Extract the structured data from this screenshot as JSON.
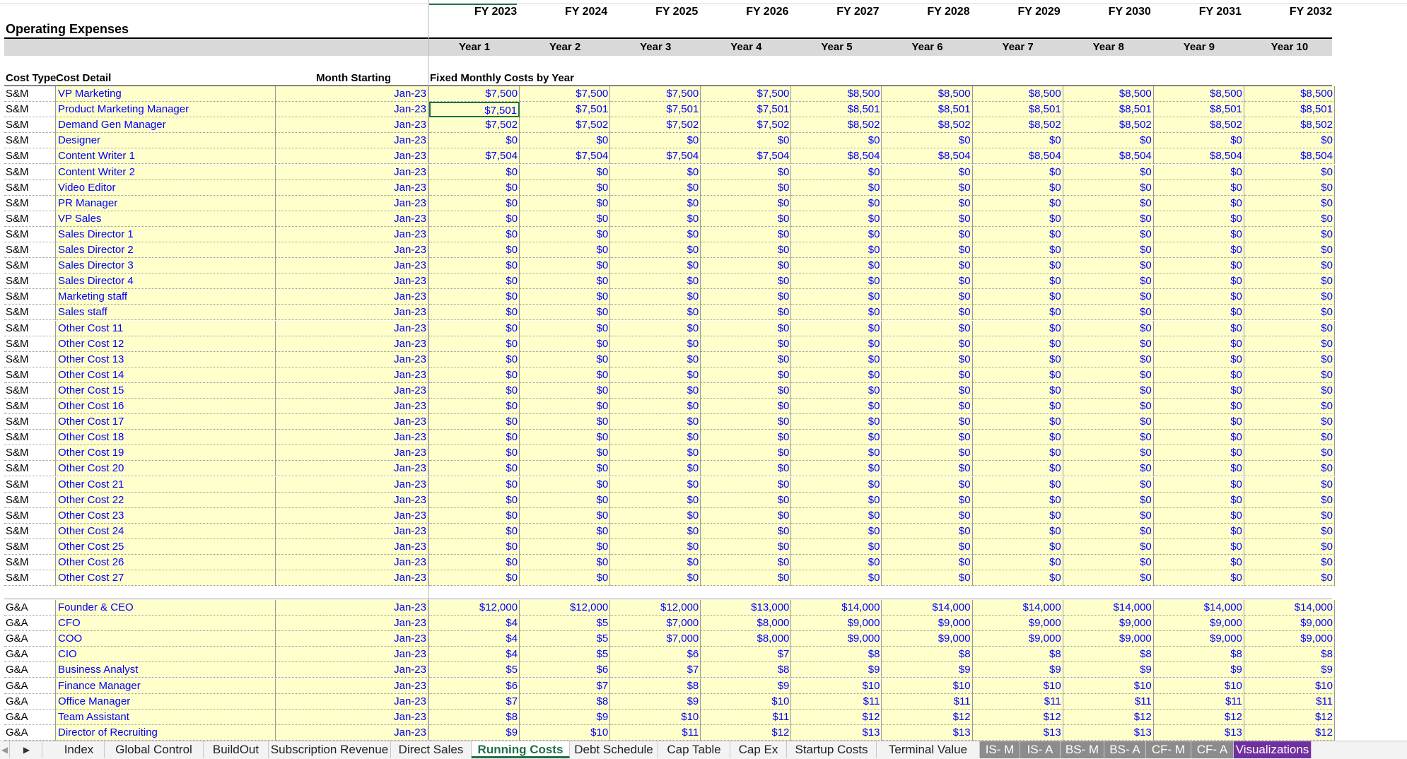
{
  "sheet_title": "Operating Expenses",
  "fy_headers": [
    "FY 2023",
    "FY 2024",
    "FY 2025",
    "FY 2026",
    "FY 2027",
    "FY 2028",
    "FY 2029",
    "FY 2030",
    "FY 2031",
    "FY 2032"
  ],
  "year_headers": [
    "Year 1",
    "Year 2",
    "Year 3",
    "Year 4",
    "Year 5",
    "Year 6",
    "Year 7",
    "Year 8",
    "Year 9",
    "Year 10"
  ],
  "column_headers": {
    "cost_type": "Cost Type",
    "cost_detail": "Cost Detail",
    "month_starting": "Month Starting",
    "fixed_costs": "Fixed Monthly Costs by Year"
  },
  "sm_rows": [
    {
      "type": "S&M",
      "detail": "VP Marketing",
      "month": "Jan-23",
      "values": [
        "$7,500",
        "$7,500",
        "$7,500",
        "$7,500",
        "$8,500",
        "$8,500",
        "$8,500",
        "$8,500",
        "$8,500",
        "$8,500"
      ]
    },
    {
      "type": "S&M",
      "detail": "Product Marketing Manager",
      "month": "Jan-23",
      "values": [
        "$7,501",
        "$7,501",
        "$7,501",
        "$7,501",
        "$8,501",
        "$8,501",
        "$8,501",
        "$8,501",
        "$8,501",
        "$8,501"
      ]
    },
    {
      "type": "S&M",
      "detail": "Demand Gen Manager",
      "month": "Jan-23",
      "values": [
        "$7,502",
        "$7,502",
        "$7,502",
        "$7,502",
        "$8,502",
        "$8,502",
        "$8,502",
        "$8,502",
        "$8,502",
        "$8,502"
      ]
    },
    {
      "type": "S&M",
      "detail": "Designer",
      "month": "Jan-23",
      "values": [
        "$0",
        "$0",
        "$0",
        "$0",
        "$0",
        "$0",
        "$0",
        "$0",
        "$0",
        "$0"
      ]
    },
    {
      "type": "S&M",
      "detail": "Content Writer 1",
      "month": "Jan-23",
      "values": [
        "$7,504",
        "$7,504",
        "$7,504",
        "$7,504",
        "$8,504",
        "$8,504",
        "$8,504",
        "$8,504",
        "$8,504",
        "$8,504"
      ]
    },
    {
      "type": "S&M",
      "detail": "Content Writer 2",
      "month": "Jan-23",
      "values": [
        "$0",
        "$0",
        "$0",
        "$0",
        "$0",
        "$0",
        "$0",
        "$0",
        "$0",
        "$0"
      ]
    },
    {
      "type": "S&M",
      "detail": "Video Editor",
      "month": "Jan-23",
      "values": [
        "$0",
        "$0",
        "$0",
        "$0",
        "$0",
        "$0",
        "$0",
        "$0",
        "$0",
        "$0"
      ]
    },
    {
      "type": "S&M",
      "detail": "PR Manager",
      "month": "Jan-23",
      "values": [
        "$0",
        "$0",
        "$0",
        "$0",
        "$0",
        "$0",
        "$0",
        "$0",
        "$0",
        "$0"
      ]
    },
    {
      "type": "S&M",
      "detail": "VP Sales",
      "month": "Jan-23",
      "values": [
        "$0",
        "$0",
        "$0",
        "$0",
        "$0",
        "$0",
        "$0",
        "$0",
        "$0",
        "$0"
      ]
    },
    {
      "type": "S&M",
      "detail": "Sales Director 1",
      "month": "Jan-23",
      "values": [
        "$0",
        "$0",
        "$0",
        "$0",
        "$0",
        "$0",
        "$0",
        "$0",
        "$0",
        "$0"
      ]
    },
    {
      "type": "S&M",
      "detail": "Sales Director 2",
      "month": "Jan-23",
      "values": [
        "$0",
        "$0",
        "$0",
        "$0",
        "$0",
        "$0",
        "$0",
        "$0",
        "$0",
        "$0"
      ]
    },
    {
      "type": "S&M",
      "detail": "Sales Director 3",
      "month": "Jan-23",
      "values": [
        "$0",
        "$0",
        "$0",
        "$0",
        "$0",
        "$0",
        "$0",
        "$0",
        "$0",
        "$0"
      ]
    },
    {
      "type": "S&M",
      "detail": "Sales Director 4",
      "month": "Jan-23",
      "values": [
        "$0",
        "$0",
        "$0",
        "$0",
        "$0",
        "$0",
        "$0",
        "$0",
        "$0",
        "$0"
      ]
    },
    {
      "type": "S&M",
      "detail": "Marketing staff",
      "month": "Jan-23",
      "values": [
        "$0",
        "$0",
        "$0",
        "$0",
        "$0",
        "$0",
        "$0",
        "$0",
        "$0",
        "$0"
      ]
    },
    {
      "type": "S&M",
      "detail": "Sales staff",
      "month": "Jan-23",
      "values": [
        "$0",
        "$0",
        "$0",
        "$0",
        "$0",
        "$0",
        "$0",
        "$0",
        "$0",
        "$0"
      ]
    },
    {
      "type": "S&M",
      "detail": "Other Cost 11",
      "month": "Jan-23",
      "values": [
        "$0",
        "$0",
        "$0",
        "$0",
        "$0",
        "$0",
        "$0",
        "$0",
        "$0",
        "$0"
      ]
    },
    {
      "type": "S&M",
      "detail": "Other Cost 12",
      "month": "Jan-23",
      "values": [
        "$0",
        "$0",
        "$0",
        "$0",
        "$0",
        "$0",
        "$0",
        "$0",
        "$0",
        "$0"
      ]
    },
    {
      "type": "S&M",
      "detail": "Other Cost 13",
      "month": "Jan-23",
      "values": [
        "$0",
        "$0",
        "$0",
        "$0",
        "$0",
        "$0",
        "$0",
        "$0",
        "$0",
        "$0"
      ]
    },
    {
      "type": "S&M",
      "detail": "Other Cost 14",
      "month": "Jan-23",
      "values": [
        "$0",
        "$0",
        "$0",
        "$0",
        "$0",
        "$0",
        "$0",
        "$0",
        "$0",
        "$0"
      ]
    },
    {
      "type": "S&M",
      "detail": "Other Cost 15",
      "month": "Jan-23",
      "values": [
        "$0",
        "$0",
        "$0",
        "$0",
        "$0",
        "$0",
        "$0",
        "$0",
        "$0",
        "$0"
      ]
    },
    {
      "type": "S&M",
      "detail": "Other Cost 16",
      "month": "Jan-23",
      "values": [
        "$0",
        "$0",
        "$0",
        "$0",
        "$0",
        "$0",
        "$0",
        "$0",
        "$0",
        "$0"
      ]
    },
    {
      "type": "S&M",
      "detail": "Other Cost 17",
      "month": "Jan-23",
      "values": [
        "$0",
        "$0",
        "$0",
        "$0",
        "$0",
        "$0",
        "$0",
        "$0",
        "$0",
        "$0"
      ]
    },
    {
      "type": "S&M",
      "detail": "Other Cost 18",
      "month": "Jan-23",
      "values": [
        "$0",
        "$0",
        "$0",
        "$0",
        "$0",
        "$0",
        "$0",
        "$0",
        "$0",
        "$0"
      ]
    },
    {
      "type": "S&M",
      "detail": "Other Cost 19",
      "month": "Jan-23",
      "values": [
        "$0",
        "$0",
        "$0",
        "$0",
        "$0",
        "$0",
        "$0",
        "$0",
        "$0",
        "$0"
      ]
    },
    {
      "type": "S&M",
      "detail": "Other Cost 20",
      "month": "Jan-23",
      "values": [
        "$0",
        "$0",
        "$0",
        "$0",
        "$0",
        "$0",
        "$0",
        "$0",
        "$0",
        "$0"
      ]
    },
    {
      "type": "S&M",
      "detail": "Other Cost 21",
      "month": "Jan-23",
      "values": [
        "$0",
        "$0",
        "$0",
        "$0",
        "$0",
        "$0",
        "$0",
        "$0",
        "$0",
        "$0"
      ]
    },
    {
      "type": "S&M",
      "detail": "Other Cost 22",
      "month": "Jan-23",
      "values": [
        "$0",
        "$0",
        "$0",
        "$0",
        "$0",
        "$0",
        "$0",
        "$0",
        "$0",
        "$0"
      ]
    },
    {
      "type": "S&M",
      "detail": "Other Cost 23",
      "month": "Jan-23",
      "values": [
        "$0",
        "$0",
        "$0",
        "$0",
        "$0",
        "$0",
        "$0",
        "$0",
        "$0",
        "$0"
      ]
    },
    {
      "type": "S&M",
      "detail": "Other Cost 24",
      "month": "Jan-23",
      "values": [
        "$0",
        "$0",
        "$0",
        "$0",
        "$0",
        "$0",
        "$0",
        "$0",
        "$0",
        "$0"
      ]
    },
    {
      "type": "S&M",
      "detail": "Other Cost 25",
      "month": "Jan-23",
      "values": [
        "$0",
        "$0",
        "$0",
        "$0",
        "$0",
        "$0",
        "$0",
        "$0",
        "$0",
        "$0"
      ]
    },
    {
      "type": "S&M",
      "detail": "Other Cost 26",
      "month": "Jan-23",
      "values": [
        "$0",
        "$0",
        "$0",
        "$0",
        "$0",
        "$0",
        "$0",
        "$0",
        "$0",
        "$0"
      ]
    },
    {
      "type": "S&M",
      "detail": "Other Cost 27",
      "month": "Jan-23",
      "values": [
        "$0",
        "$0",
        "$0",
        "$0",
        "$0",
        "$0",
        "$0",
        "$0",
        "$0",
        "$0"
      ]
    }
  ],
  "ga_rows": [
    {
      "type": "G&A",
      "detail": "Founder & CEO",
      "month": "Jan-23",
      "values": [
        "$12,000",
        "$12,000",
        "$12,000",
        "$13,000",
        "$14,000",
        "$14,000",
        "$14,000",
        "$14,000",
        "$14,000",
        "$14,000"
      ]
    },
    {
      "type": "G&A",
      "detail": "CFO",
      "month": "Jan-23",
      "values": [
        "$4",
        "$5",
        "$7,000",
        "$8,000",
        "$9,000",
        "$9,000",
        "$9,000",
        "$9,000",
        "$9,000",
        "$9,000"
      ]
    },
    {
      "type": "G&A",
      "detail": "COO",
      "month": "Jan-23",
      "values": [
        "$4",
        "$5",
        "$7,000",
        "$8,000",
        "$9,000",
        "$9,000",
        "$9,000",
        "$9,000",
        "$9,000",
        "$9,000"
      ]
    },
    {
      "type": "G&A",
      "detail": "CIO",
      "month": "Jan-23",
      "values": [
        "$4",
        "$5",
        "$6",
        "$7",
        "$8",
        "$8",
        "$8",
        "$8",
        "$8",
        "$8"
      ]
    },
    {
      "type": "G&A",
      "detail": "Business Analyst",
      "month": "Jan-23",
      "values": [
        "$5",
        "$6",
        "$7",
        "$8",
        "$9",
        "$9",
        "$9",
        "$9",
        "$9",
        "$9"
      ]
    },
    {
      "type": "G&A",
      "detail": "Finance Manager",
      "month": "Jan-23",
      "values": [
        "$6",
        "$7",
        "$8",
        "$9",
        "$10",
        "$10",
        "$10",
        "$10",
        "$10",
        "$10"
      ]
    },
    {
      "type": "G&A",
      "detail": "Office Manager",
      "month": "Jan-23",
      "values": [
        "$7",
        "$8",
        "$9",
        "$10",
        "$11",
        "$11",
        "$11",
        "$11",
        "$11",
        "$11"
      ]
    },
    {
      "type": "G&A",
      "detail": "Team Assistant",
      "month": "Jan-23",
      "values": [
        "$8",
        "$9",
        "$10",
        "$11",
        "$12",
        "$12",
        "$12",
        "$12",
        "$12",
        "$12"
      ]
    },
    {
      "type": "G&A",
      "detail": "Director of Recruiting",
      "month": "Jan-23",
      "values": [
        "$9",
        "$10",
        "$11",
        "$12",
        "$13",
        "$13",
        "$13",
        "$13",
        "$13",
        "$12"
      ]
    }
  ],
  "tabs": [
    {
      "label": "Index",
      "style": "normal"
    },
    {
      "label": "Global Control",
      "style": "normal"
    },
    {
      "label": "BuildOut",
      "style": "normal"
    },
    {
      "label": "Subscription Revenue",
      "style": "normal"
    },
    {
      "label": "Direct Sales",
      "style": "normal"
    },
    {
      "label": "Running Costs",
      "style": "active"
    },
    {
      "label": "Debt Schedule",
      "style": "normal"
    },
    {
      "label": "Cap Table",
      "style": "normal"
    },
    {
      "label": "Cap Ex",
      "style": "normal"
    },
    {
      "label": "Startup Costs",
      "style": "normal"
    },
    {
      "label": "Terminal Value",
      "style": "normal"
    },
    {
      "label": "IS- M",
      "style": "grey"
    },
    {
      "label": "IS- A",
      "style": "grey"
    },
    {
      "label": "BS- M",
      "style": "grey"
    },
    {
      "label": "BS- A",
      "style": "grey"
    },
    {
      "label": "CF- M",
      "style": "grey"
    },
    {
      "label": "CF- A",
      "style": "grey"
    },
    {
      "label": "Visualizations",
      "style": "purple"
    }
  ],
  "colors": {
    "input_fill": "#ffffcc",
    "input_text": "#0000ff",
    "header_band": "#d9d9d9",
    "active_tab": "#1e7145",
    "grey_tab": "#8c8c8c",
    "purple_tab": "#7030a0"
  },
  "icons": {
    "scroll_left": "scroll-left-icon",
    "scroll_right": "scroll-right-icon"
  }
}
